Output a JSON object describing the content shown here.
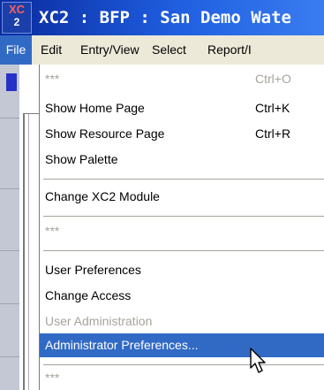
{
  "window": {
    "title": "XC2 : BFP : San Demo Wate",
    "icon_top": "XC",
    "icon_bottom": "2"
  },
  "menubar": {
    "items": [
      "File",
      "Edit",
      "Entry/View",
      "Select",
      "Report/I"
    ],
    "active": "File"
  },
  "file_menu": {
    "items": [
      {
        "label": "***",
        "shortcut": "Ctrl+O",
        "state": "disabled"
      },
      {
        "label": "Show Home Page",
        "shortcut": "Ctrl+K",
        "state": "enabled"
      },
      {
        "label": "Show Resource Page",
        "shortcut": "Ctrl+R",
        "state": "enabled"
      },
      {
        "label": "Show Palette",
        "shortcut": "",
        "state": "enabled"
      },
      {
        "label": "Change XC2 Module",
        "shortcut": "",
        "state": "enabled"
      },
      {
        "label": "***",
        "shortcut": "",
        "state": "disabled"
      },
      {
        "label": "User Preferences",
        "shortcut": "",
        "state": "enabled"
      },
      {
        "label": "Change Access",
        "shortcut": "",
        "state": "enabled"
      },
      {
        "label": "User Administration",
        "shortcut": "",
        "state": "disabled"
      },
      {
        "label": "Administrator Preferences...",
        "shortcut": "",
        "state": "highlighted"
      },
      {
        "label": "***",
        "shortcut": "",
        "state": "disabled"
      }
    ]
  },
  "colors": {
    "highlight": "#316ac5",
    "disabled_text": "#a7a39a",
    "titlebar": "#1f5fe0"
  },
  "cursor": "arrow-pointer-icon"
}
